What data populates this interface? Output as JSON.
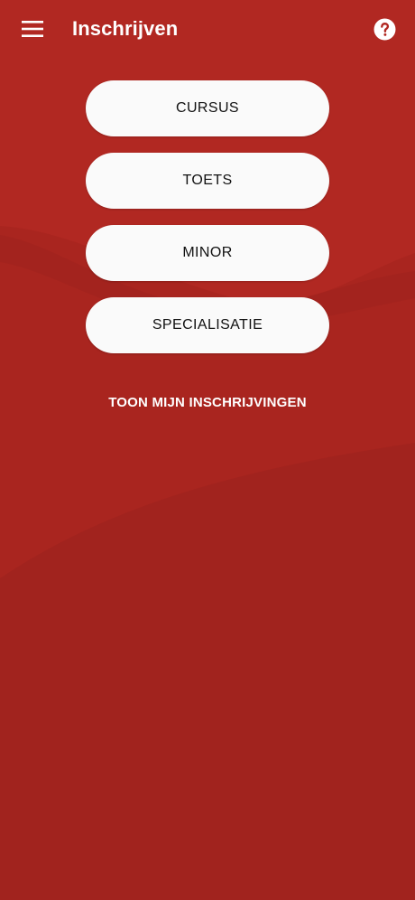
{
  "app_bar": {
    "title": "Inschrijven",
    "menu_icon": "hamburger-menu-icon",
    "help_icon": "help-circle-icon"
  },
  "buttons": [
    {
      "label": "CURSUS"
    },
    {
      "label": "TOETS"
    },
    {
      "label": "MINOR"
    },
    {
      "label": "SPECIALISATIE"
    }
  ],
  "link": {
    "label": "TOON MIJN INSCHRIJVINGEN"
  },
  "colors": {
    "background": "#b02722",
    "background_dark": "#9e231e",
    "button_bg": "#fafafa",
    "button_text": "#111111",
    "app_bar_text": "#ffffff"
  }
}
